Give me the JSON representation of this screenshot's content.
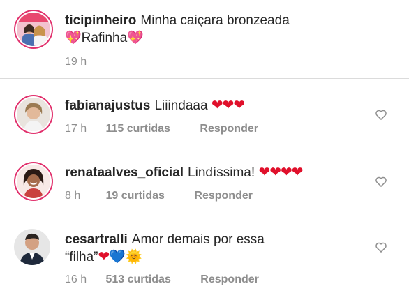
{
  "caption": {
    "username": "ticipinheiro",
    "text_line1": "Minha caiçara bronzeada",
    "text_line2_prefix": "💖",
    "text_line2_name": "Rafinha",
    "text_line2_suffix": "💖",
    "time": "19 h"
  },
  "comments": [
    {
      "username": "fabianajustus",
      "text": "Liiindaaa",
      "emoji": "❤❤❤",
      "time": "17 h",
      "likes": "115 curtidas",
      "reply": "Responder"
    },
    {
      "username": "renataalves_oficial",
      "text": "Lindíssima!",
      "emoji": "❤❤❤❤",
      "time": "8 h",
      "likes": "19 curtidas",
      "reply": "Responder"
    },
    {
      "username": "cesartralli",
      "text": "Amor demais por essa",
      "text_line2": "“filha”",
      "emoji_red": "❤",
      "emoji_blue": "💙",
      "emoji_sun": "🌞",
      "time": "16 h",
      "likes": "513 curtidas",
      "reply": "Responder"
    }
  ],
  "colors": {
    "text": "#262626",
    "muted": "#8e8e8e",
    "heart": "#e0102b",
    "divider": "#dbdbdb",
    "story_ring": "#e1306c"
  },
  "icons": {
    "like": "heart-outline-icon"
  }
}
